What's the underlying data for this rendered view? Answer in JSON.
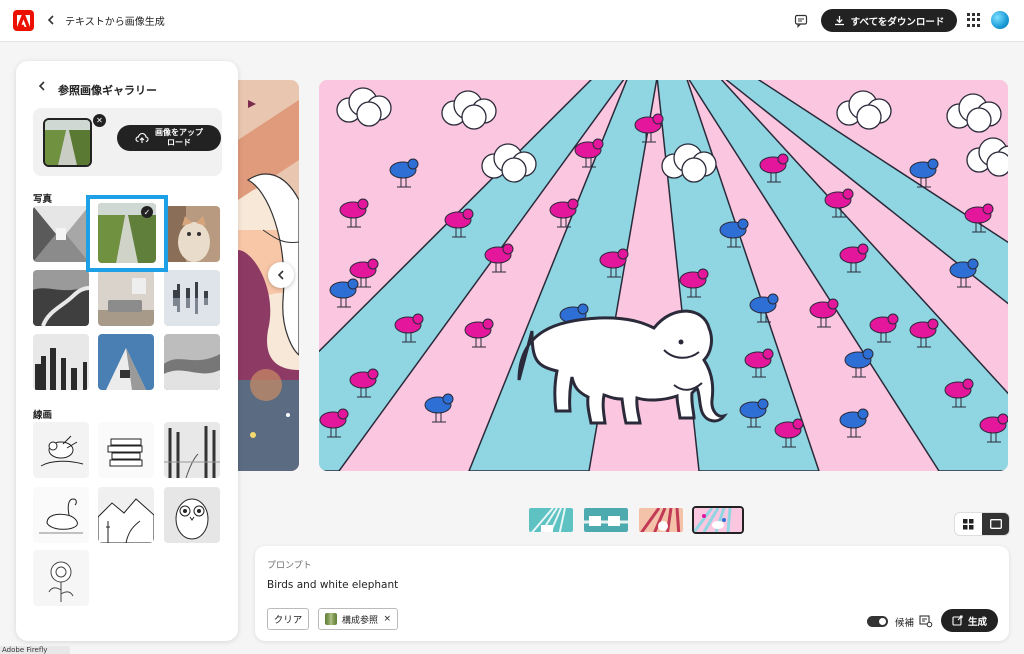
{
  "header": {
    "app_title": "テキストから画像生成",
    "download_label": "すべてをダウンロード",
    "icons": [
      "adobe-logo",
      "back-chevron",
      "feedback-icon",
      "download-icon",
      "apps-grid-icon",
      "avatar"
    ]
  },
  "gallery": {
    "title": "参照画像ギャラリー",
    "upload_label_1": "画像をアップ",
    "upload_label_2": "ロード",
    "section_photo": "写真",
    "section_lineart": "線画",
    "selected_index": 1
  },
  "prompt": {
    "label": "プロンプト",
    "text": "Birds and white elephant",
    "clear_label": "クリア",
    "chip_label": "構成参照",
    "chip_remove": "×",
    "candidate_label": "候補",
    "generate_label": "生成",
    "candidate_toggle_on": true
  },
  "results": {
    "thumbnail_count": 4,
    "active_thumbnail": 3
  },
  "footer": {
    "text": "Adobe Firefly"
  },
  "colors": {
    "accent_selection": "#1ea0e6",
    "adobe_red": "#eb1000",
    "button_dark": "#222222"
  }
}
